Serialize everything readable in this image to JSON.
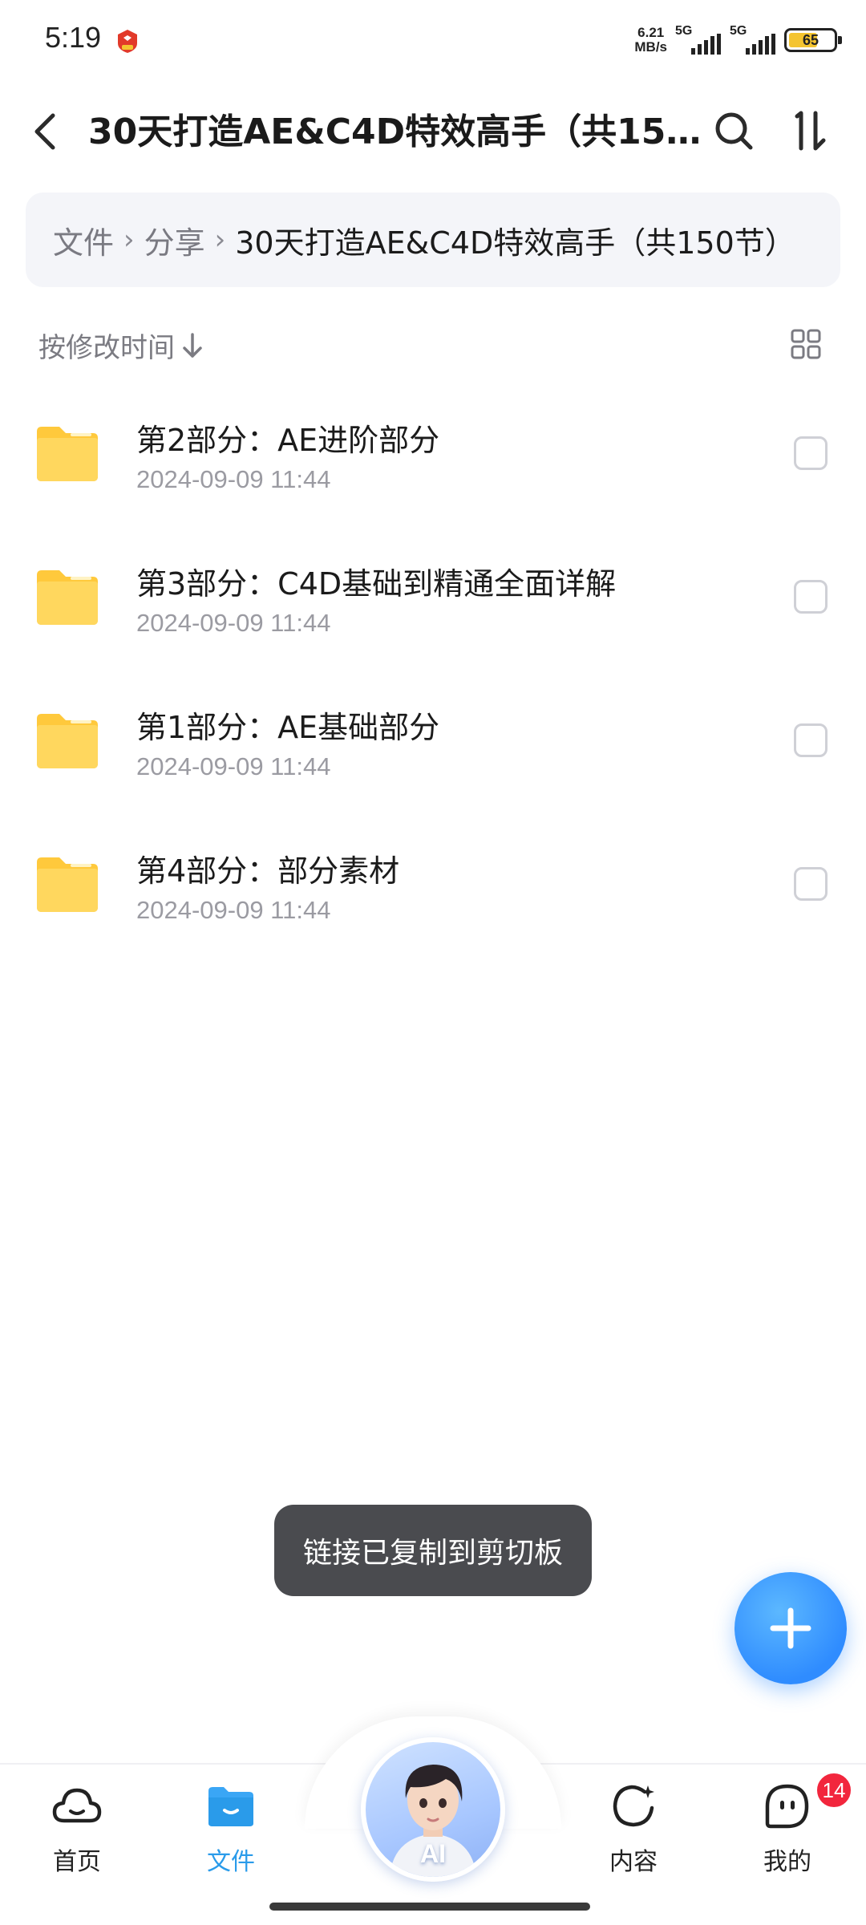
{
  "status_bar": {
    "time": "5:19",
    "net_speed_value": "6.21",
    "net_speed_unit": "MB/s",
    "sim1": "5G",
    "sim2": "5G",
    "battery_level": "65",
    "battery_fill_percent": 65
  },
  "header": {
    "title": "30天打造AE&C4D特效高手（共150节）",
    "back_icon": "chevron-left-icon",
    "search_icon": "search-icon",
    "sort_icon": "sort-icon"
  },
  "breadcrumb": {
    "items": [
      "文件",
      "分享",
      "30天打造AE&C4D特效高手（共150节）"
    ]
  },
  "sort_bar": {
    "label": "按修改时间",
    "direction_icon": "arrow-down-icon",
    "view_icon": "grid-view-icon"
  },
  "files": [
    {
      "name": "第2部分：AE进阶部分",
      "date": "2024-09-09 11:44"
    },
    {
      "name": "第3部分：C4D基础到精通全面详解",
      "date": "2024-09-09 11:44"
    },
    {
      "name": "第1部分：AE基础部分",
      "date": "2024-09-09 11:44"
    },
    {
      "name": "第4部分：部分素材",
      "date": "2024-09-09 11:44"
    }
  ],
  "toast": {
    "message": "链接已复制到剪切板"
  },
  "fab": {
    "icon": "plus-icon"
  },
  "bottom_nav": {
    "home": "首页",
    "files": "文件",
    "ai": "AI",
    "content": "内容",
    "me": "我的",
    "me_badge": "14"
  },
  "colors": {
    "accent": "#2a9bea",
    "folder": "#ffd460",
    "toast_bg": "#4a4b4f",
    "badge": "#f2263d"
  }
}
